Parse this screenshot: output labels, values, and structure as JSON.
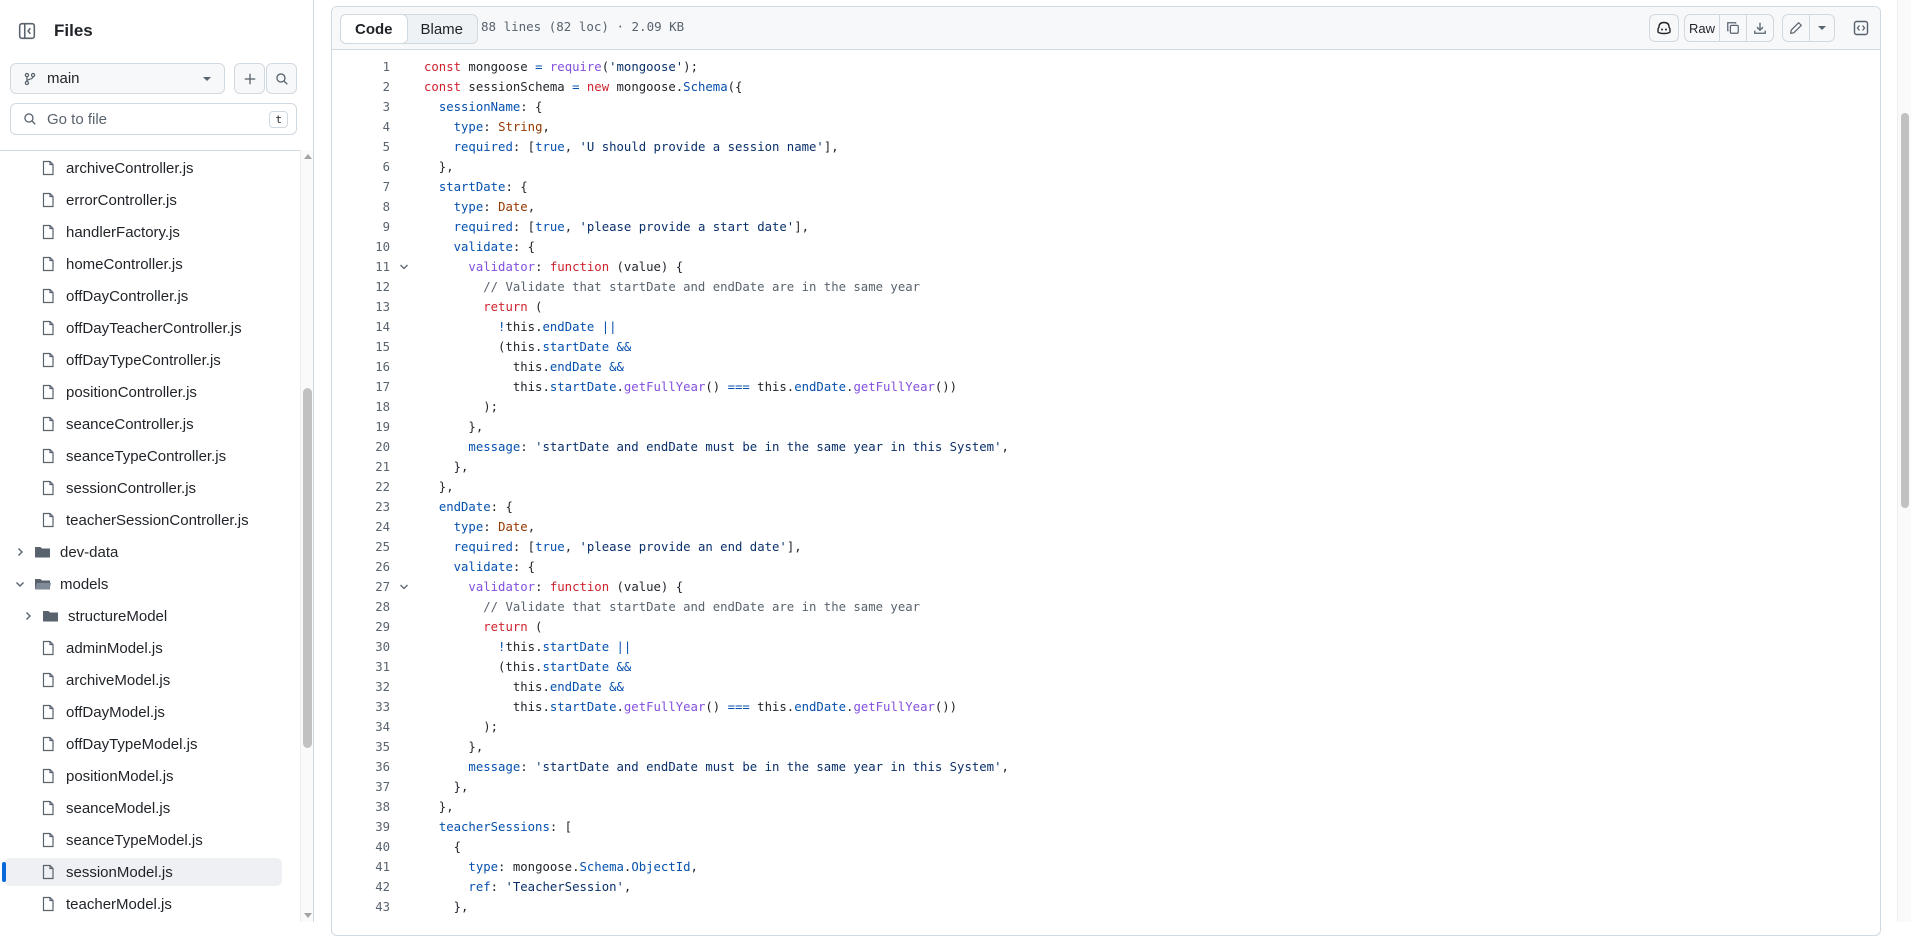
{
  "sidebar": {
    "title": "Files",
    "branch": "main",
    "search_placeholder": "Go to file",
    "search_shortcut": "t",
    "tree": [
      {
        "label": "archiveController.js",
        "type": "file",
        "depth": 1
      },
      {
        "label": "errorController.js",
        "type": "file",
        "depth": 1
      },
      {
        "label": "handlerFactory.js",
        "type": "file",
        "depth": 1
      },
      {
        "label": "homeController.js",
        "type": "file",
        "depth": 1
      },
      {
        "label": "offDayController.js",
        "type": "file",
        "depth": 1
      },
      {
        "label": "offDayTeacherController.js",
        "type": "file",
        "depth": 1
      },
      {
        "label": "offDayTypeController.js",
        "type": "file",
        "depth": 1
      },
      {
        "label": "positionController.js",
        "type": "file",
        "depth": 1
      },
      {
        "label": "seanceController.js",
        "type": "file",
        "depth": 1
      },
      {
        "label": "seanceTypeController.js",
        "type": "file",
        "depth": 1
      },
      {
        "label": "sessionController.js",
        "type": "file",
        "depth": 1
      },
      {
        "label": "teacherSessionController.js",
        "type": "file",
        "depth": 1
      },
      {
        "label": "dev-data",
        "type": "folder",
        "depth": 0,
        "expanded": false
      },
      {
        "label": "models",
        "type": "folder-open",
        "depth": 0,
        "expanded": true
      },
      {
        "label": "structureModel",
        "type": "folder",
        "depth": 1,
        "expanded": false
      },
      {
        "label": "adminModel.js",
        "type": "file",
        "depth": 1
      },
      {
        "label": "archiveModel.js",
        "type": "file",
        "depth": 1
      },
      {
        "label": "offDayModel.js",
        "type": "file",
        "depth": 1
      },
      {
        "label": "offDayTypeModel.js",
        "type": "file",
        "depth": 1
      },
      {
        "label": "positionModel.js",
        "type": "file",
        "depth": 1
      },
      {
        "label": "seanceModel.js",
        "type": "file",
        "depth": 1
      },
      {
        "label": "seanceTypeModel.js",
        "type": "file",
        "depth": 1
      },
      {
        "label": "sessionModel.js",
        "type": "file",
        "depth": 1,
        "selected": true
      },
      {
        "label": "teacherModel.js",
        "type": "file",
        "depth": 1
      }
    ]
  },
  "viewer": {
    "tabs": [
      {
        "label": "Code",
        "active": true
      },
      {
        "label": "Blame",
        "active": false
      }
    ],
    "file_info": "88 lines (82 loc) · 2.09 KB",
    "raw_label": "Raw"
  },
  "colors": {
    "keyword": "#cf222e",
    "property": "#0550ae",
    "string": "#0a3069",
    "type": "#953800",
    "function": "#8250df",
    "comment": "#59636e",
    "plain": "#1f2328",
    "accent": "#0969da"
  },
  "code": [
    {
      "n": "1",
      "tokens": [
        [
          "k",
          "const"
        ],
        [
          "p",
          " mongoose "
        ],
        [
          "o",
          "="
        ],
        [
          "p",
          " "
        ],
        [
          "f",
          "require"
        ],
        [
          "p",
          "("
        ],
        [
          "s",
          "'mongoose'"
        ],
        [
          "p",
          ");"
        ]
      ]
    },
    {
      "n": "2",
      "tokens": [
        [
          "k",
          "const"
        ],
        [
          "p",
          " sessionSchema "
        ],
        [
          "o",
          "="
        ],
        [
          "p",
          " "
        ],
        [
          "k",
          "new"
        ],
        [
          "p",
          " mongoose."
        ],
        [
          "a",
          "Schema"
        ],
        [
          "p",
          "({"
        ]
      ]
    },
    {
      "n": "3",
      "tokens": [
        [
          "p",
          "  "
        ],
        [
          "a",
          "sessionName"
        ],
        [
          "p",
          ": {"
        ]
      ]
    },
    {
      "n": "4",
      "tokens": [
        [
          "p",
          "    "
        ],
        [
          "a",
          "type"
        ],
        [
          "p",
          ": "
        ],
        [
          "t",
          "String"
        ],
        [
          "p",
          ","
        ]
      ]
    },
    {
      "n": "5",
      "tokens": [
        [
          "p",
          "    "
        ],
        [
          "a",
          "required"
        ],
        [
          "p",
          ": ["
        ],
        [
          "a",
          "true"
        ],
        [
          "p",
          ", "
        ],
        [
          "s",
          "'U should provide a session name'"
        ],
        [
          "p",
          "],"
        ]
      ]
    },
    {
      "n": "6",
      "tokens": [
        [
          "p",
          "  },"
        ]
      ]
    },
    {
      "n": "7",
      "tokens": [
        [
          "p",
          "  "
        ],
        [
          "a",
          "startDate"
        ],
        [
          "p",
          ": {"
        ]
      ]
    },
    {
      "n": "8",
      "tokens": [
        [
          "p",
          "    "
        ],
        [
          "a",
          "type"
        ],
        [
          "p",
          ": "
        ],
        [
          "t",
          "Date"
        ],
        [
          "p",
          ","
        ]
      ]
    },
    {
      "n": "9",
      "tokens": [
        [
          "p",
          "    "
        ],
        [
          "a",
          "required"
        ],
        [
          "p",
          ": ["
        ],
        [
          "a",
          "true"
        ],
        [
          "p",
          ", "
        ],
        [
          "s",
          "'please provide a start date'"
        ],
        [
          "p",
          "],"
        ]
      ]
    },
    {
      "n": "10",
      "tokens": [
        [
          "p",
          "    "
        ],
        [
          "a",
          "validate"
        ],
        [
          "p",
          ": {"
        ]
      ]
    },
    {
      "n": "11",
      "fold": true,
      "tokens": [
        [
          "p",
          "      "
        ],
        [
          "f",
          "validator"
        ],
        [
          "p",
          ": "
        ],
        [
          "k",
          "function"
        ],
        [
          "p",
          " (value) {"
        ]
      ]
    },
    {
      "n": "12",
      "tokens": [
        [
          "p",
          "        "
        ],
        [
          "c",
          "// Validate that startDate and endDate are in the same year"
        ]
      ]
    },
    {
      "n": "13",
      "tokens": [
        [
          "p",
          "        "
        ],
        [
          "k",
          "return"
        ],
        [
          "p",
          " ("
        ]
      ]
    },
    {
      "n": "14",
      "tokens": [
        [
          "p",
          "          "
        ],
        [
          "o",
          "!"
        ],
        [
          "p",
          "this."
        ],
        [
          "a",
          "endDate"
        ],
        [
          "p",
          " "
        ],
        [
          "o",
          "||"
        ]
      ]
    },
    {
      "n": "15",
      "tokens": [
        [
          "p",
          "          (this."
        ],
        [
          "a",
          "startDate"
        ],
        [
          "p",
          " "
        ],
        [
          "o",
          "&&"
        ]
      ]
    },
    {
      "n": "16",
      "tokens": [
        [
          "p",
          "            this."
        ],
        [
          "a",
          "endDate"
        ],
        [
          "p",
          " "
        ],
        [
          "o",
          "&&"
        ]
      ]
    },
    {
      "n": "17",
      "tokens": [
        [
          "p",
          "            this."
        ],
        [
          "a",
          "startDate"
        ],
        [
          "p",
          "."
        ],
        [
          "f",
          "getFullYear"
        ],
        [
          "p",
          "() "
        ],
        [
          "o",
          "==="
        ],
        [
          "p",
          " this."
        ],
        [
          "a",
          "endDate"
        ],
        [
          "p",
          "."
        ],
        [
          "f",
          "getFullYear"
        ],
        [
          "p",
          "())"
        ]
      ]
    },
    {
      "n": "18",
      "tokens": [
        [
          "p",
          "        );"
        ]
      ]
    },
    {
      "n": "19",
      "tokens": [
        [
          "p",
          "      },"
        ]
      ]
    },
    {
      "n": "20",
      "tokens": [
        [
          "p",
          "      "
        ],
        [
          "a",
          "message"
        ],
        [
          "p",
          ": "
        ],
        [
          "s",
          "'startDate and endDate must be in the same year in this System'"
        ],
        [
          "p",
          ","
        ]
      ]
    },
    {
      "n": "21",
      "tokens": [
        [
          "p",
          "    },"
        ]
      ]
    },
    {
      "n": "22",
      "tokens": [
        [
          "p",
          "  },"
        ]
      ]
    },
    {
      "n": "23",
      "tokens": [
        [
          "p",
          "  "
        ],
        [
          "a",
          "endDate"
        ],
        [
          "p",
          ": {"
        ]
      ]
    },
    {
      "n": "24",
      "tokens": [
        [
          "p",
          "    "
        ],
        [
          "a",
          "type"
        ],
        [
          "p",
          ": "
        ],
        [
          "t",
          "Date"
        ],
        [
          "p",
          ","
        ]
      ]
    },
    {
      "n": "25",
      "tokens": [
        [
          "p",
          "    "
        ],
        [
          "a",
          "required"
        ],
        [
          "p",
          ": ["
        ],
        [
          "a",
          "true"
        ],
        [
          "p",
          ", "
        ],
        [
          "s",
          "'please provide an end date'"
        ],
        [
          "p",
          "],"
        ]
      ]
    },
    {
      "n": "26",
      "tokens": [
        [
          "p",
          "    "
        ],
        [
          "a",
          "validate"
        ],
        [
          "p",
          ": {"
        ]
      ]
    },
    {
      "n": "27",
      "fold": true,
      "tokens": [
        [
          "p",
          "      "
        ],
        [
          "f",
          "validator"
        ],
        [
          "p",
          ": "
        ],
        [
          "k",
          "function"
        ],
        [
          "p",
          " (value) {"
        ]
      ]
    },
    {
      "n": "28",
      "tokens": [
        [
          "p",
          "        "
        ],
        [
          "c",
          "// Validate that startDate and endDate are in the same year"
        ]
      ]
    },
    {
      "n": "29",
      "tokens": [
        [
          "p",
          "        "
        ],
        [
          "k",
          "return"
        ],
        [
          "p",
          " ("
        ]
      ]
    },
    {
      "n": "30",
      "tokens": [
        [
          "p",
          "          "
        ],
        [
          "o",
          "!"
        ],
        [
          "p",
          "this."
        ],
        [
          "a",
          "startDate"
        ],
        [
          "p",
          " "
        ],
        [
          "o",
          "||"
        ]
      ]
    },
    {
      "n": "31",
      "tokens": [
        [
          "p",
          "          (this."
        ],
        [
          "a",
          "startDate"
        ],
        [
          "p",
          " "
        ],
        [
          "o",
          "&&"
        ]
      ]
    },
    {
      "n": "32",
      "tokens": [
        [
          "p",
          "            this."
        ],
        [
          "a",
          "endDate"
        ],
        [
          "p",
          " "
        ],
        [
          "o",
          "&&"
        ]
      ]
    },
    {
      "n": "33",
      "tokens": [
        [
          "p",
          "            this."
        ],
        [
          "a",
          "startDate"
        ],
        [
          "p",
          "."
        ],
        [
          "f",
          "getFullYear"
        ],
        [
          "p",
          "() "
        ],
        [
          "o",
          "==="
        ],
        [
          "p",
          " this."
        ],
        [
          "a",
          "endDate"
        ],
        [
          "p",
          "."
        ],
        [
          "f",
          "getFullYear"
        ],
        [
          "p",
          "())"
        ]
      ]
    },
    {
      "n": "34",
      "tokens": [
        [
          "p",
          "        );"
        ]
      ]
    },
    {
      "n": "35",
      "tokens": [
        [
          "p",
          "      },"
        ]
      ]
    },
    {
      "n": "36",
      "tokens": [
        [
          "p",
          "      "
        ],
        [
          "a",
          "message"
        ],
        [
          "p",
          ": "
        ],
        [
          "s",
          "'startDate and endDate must be in the same year in this System'"
        ],
        [
          "p",
          ","
        ]
      ]
    },
    {
      "n": "37",
      "tokens": [
        [
          "p",
          "    },"
        ]
      ]
    },
    {
      "n": "38",
      "tokens": [
        [
          "p",
          "  },"
        ]
      ]
    },
    {
      "n": "39",
      "tokens": [
        [
          "p",
          "  "
        ],
        [
          "a",
          "teacherSessions"
        ],
        [
          "p",
          ": ["
        ]
      ]
    },
    {
      "n": "40",
      "tokens": [
        [
          "p",
          "    {"
        ]
      ]
    },
    {
      "n": "41",
      "tokens": [
        [
          "p",
          "      "
        ],
        [
          "a",
          "type"
        ],
        [
          "p",
          ": mongoose."
        ],
        [
          "a",
          "Schema"
        ],
        [
          "p",
          "."
        ],
        [
          "a",
          "ObjectId"
        ],
        [
          "p",
          ","
        ]
      ]
    },
    {
      "n": "42",
      "tokens": [
        [
          "p",
          "      "
        ],
        [
          "a",
          "ref"
        ],
        [
          "p",
          ": "
        ],
        [
          "s",
          "'TeacherSession'"
        ],
        [
          "p",
          ","
        ]
      ]
    },
    {
      "n": "43",
      "tokens": [
        [
          "p",
          "    },"
        ]
      ]
    }
  ]
}
